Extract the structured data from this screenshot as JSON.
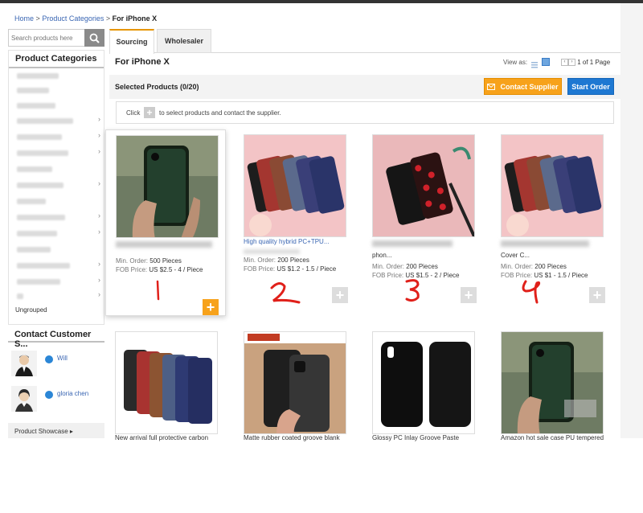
{
  "breadcrumb": {
    "home": "Home",
    "sep": ">",
    "categories": "Product Categories",
    "current": "For iPhone X"
  },
  "search": {
    "placeholder": "Search products here",
    "icon": "search-icon"
  },
  "sidebar": {
    "title": "Product Categories",
    "ungrouped": "Ungrouped"
  },
  "contact": {
    "title": "Contact Customer S...",
    "people": [
      {
        "name": "Will"
      },
      {
        "name": "gloria chen"
      }
    ],
    "showcase": "Product Showcase ▸"
  },
  "tabs": [
    {
      "label": "Sourcing"
    },
    {
      "label": "Wholesaler"
    }
  ],
  "main": {
    "heading": "For iPhone X",
    "view_as": "View as:",
    "pager": "1 of 1 Page",
    "selected": "Selected Products (0/20)",
    "contact_btn": "Contact Supplier",
    "order_btn": "Start Order",
    "hint_click": "Click",
    "hint_rest": "to select products and contact the supplier."
  },
  "products": [
    {
      "title": "",
      "min_order_label": "Min. Order:",
      "min_order": "500 Pieces",
      "fob_label": "FOB Price:",
      "fob": "US $2.5 - 4 / Piece",
      "annotation": "1"
    },
    {
      "title": "High quality hybrid PC+TPU...",
      "min_order_label": "Min. Order:",
      "min_order": "200 Pieces",
      "fob_label": "FOB Price:",
      "fob": "US $1.2 - 1.5 / Piece",
      "annotation": "2"
    },
    {
      "title": "phon...",
      "min_order_label": "Min. Order:",
      "min_order": "200 Pieces",
      "fob_label": "FOB Price:",
      "fob": "US $1.5 - 2 / Piece",
      "annotation": "3"
    },
    {
      "title": "Cover C...",
      "min_order_label": "Min. Order:",
      "min_order": "200 Pieces",
      "fob_label": "FOB Price:",
      "fob": "US $1 - 1.5 / Piece",
      "annotation": "4"
    },
    {
      "title": "New arrival full protective carbon"
    },
    {
      "title": "Matte rubber coated groove blank"
    },
    {
      "title": "Glossy PC Inlay Groove Paste"
    },
    {
      "title": "Amazon hot sale case PU tempered"
    }
  ],
  "colors": {
    "accent_orange": "#f7a21b",
    "accent_blue": "#1e78d2",
    "link": "#3a66b3",
    "annotation_red": "#e0201a"
  }
}
